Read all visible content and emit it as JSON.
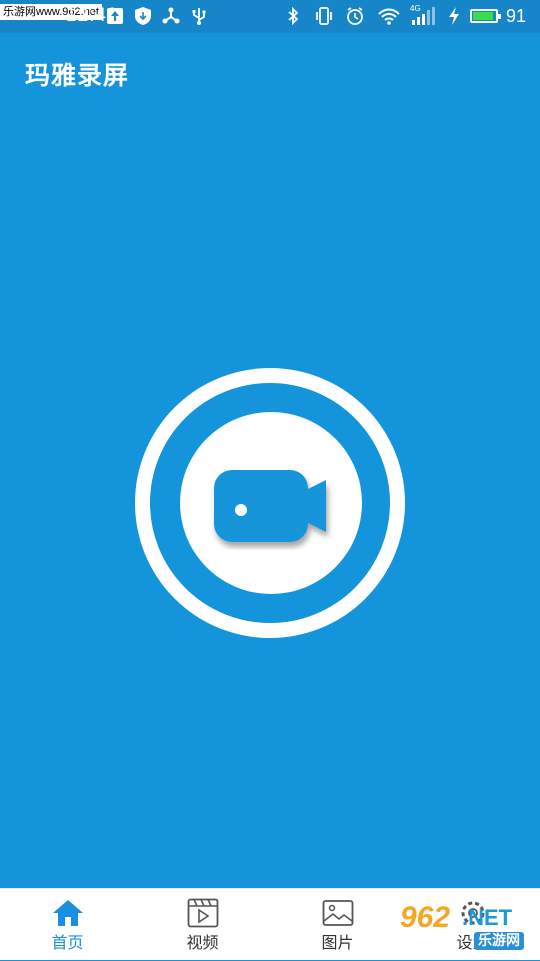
{
  "status_bar": {
    "watermark_text": "乐游网www.962.net",
    "time_partial": "12:40",
    "battery_percent": 91,
    "battery_label": "91",
    "network_label": "4G",
    "icons": [
      "notification-icon",
      "upload-icon",
      "shield-download-icon",
      "share-icon",
      "usb-icon",
      "bluetooth-icon",
      "vibrate-icon",
      "alarm-icon",
      "wifi-icon",
      "signal-icon",
      "charging-icon",
      "battery-icon"
    ]
  },
  "app": {
    "title": "玛雅录屏"
  },
  "main": {
    "record_button_icon": "video-camera-icon"
  },
  "bottom_nav": {
    "items": [
      {
        "label": "首页",
        "icon": "home-icon",
        "active": true
      },
      {
        "label": "视频",
        "icon": "video-icon",
        "active": false
      },
      {
        "label": "图片",
        "icon": "image-icon",
        "active": false
      },
      {
        "label": "设置",
        "icon": "settings-icon",
        "active": false
      }
    ]
  },
  "watermark": {
    "number": "962",
    "suffix": ".NET",
    "site_name": "乐游网"
  },
  "colors": {
    "background": "#1495db",
    "status_bar": "#1786c8",
    "nav_active": "#1a8ee0",
    "battery_fill": "#3ddc4a"
  }
}
